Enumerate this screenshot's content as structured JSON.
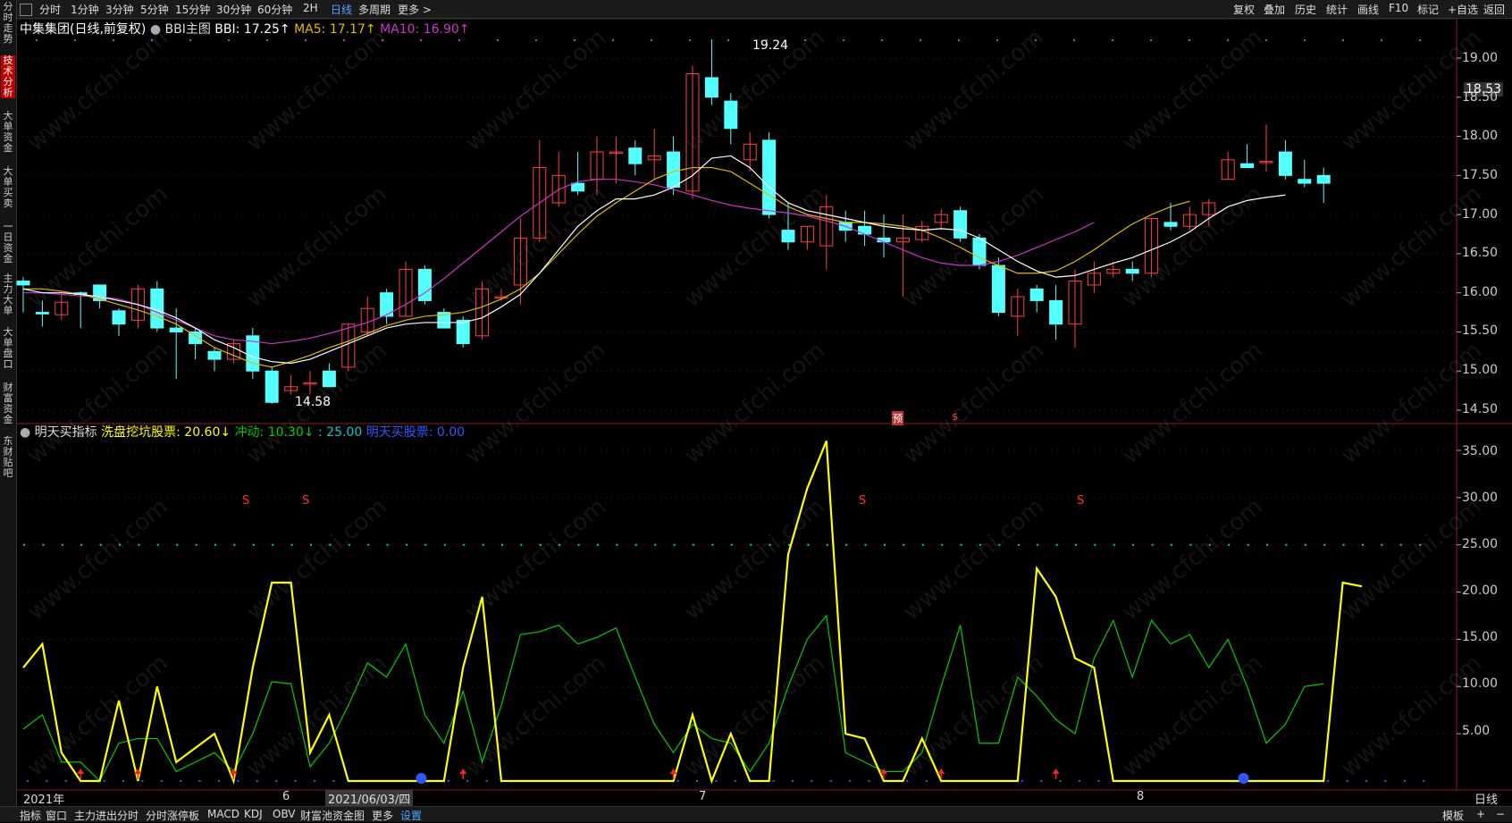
{
  "toolbar": {
    "tabs": [
      "分时",
      "1分钟",
      "3分钟",
      "5分钟",
      "15分钟",
      "30分钟",
      "60分钟",
      "2H",
      "日线",
      "多周期",
      "更多 >"
    ],
    "active_tab": "日线",
    "right_buttons": [
      "复权",
      "叠加",
      "历史",
      "统计",
      "画线",
      "F10",
      "标记",
      "+自选",
      "返回"
    ]
  },
  "sidebar": {
    "items": [
      "分时走势",
      "技术分析",
      "大单资金",
      "大单买卖",
      "一日资金",
      "主力大单",
      "大单盘口",
      "财富资金",
      "东财贴吧"
    ],
    "active_item": "技术分析"
  },
  "main_panel": {
    "title": "中集集团(日线,前复权)",
    "indicator_name": "BBI主图",
    "bbi_label": "BBI: 17.25↑",
    "ma5_label": "MA5: 17.17↑",
    "ma10_label": "MA10: 16.90↑",
    "high_label": "19.24",
    "low_label": "14.58",
    "current_price": "18.53",
    "yu_marker": "预",
    "s_marker": "$",
    "y_axis": [
      "19.00",
      "18.50",
      "18.00",
      "17.50",
      "17.00",
      "16.50",
      "16.00",
      "15.50",
      "15.00",
      "14.50"
    ]
  },
  "sub_panel": {
    "title": "明天买指标",
    "label1": "洗盘挖坑股票: 20.60↓",
    "label2": "冲动: 10.30↓",
    "label3": ": 25.00",
    "label4": "明天买股票: 0.00",
    "s_label": "S",
    "y_axis": [
      "35.00",
      "30.00",
      "25.00",
      "20.00",
      "15.00",
      "10.00",
      "5.00"
    ]
  },
  "dates": {
    "year": "2021年",
    "m6": "6",
    "selected": "2021/06/03/四",
    "m7": "7",
    "m8": "8",
    "period": "日线"
  },
  "bottom_tabs": [
    "指标",
    "窗口",
    "主力进出分时",
    "分时涨停板",
    "MACD",
    "KDJ",
    "OBV",
    "财富池资金图",
    "更多",
    "设置"
  ],
  "bottom_right": [
    "模板",
    "+",
    "−"
  ],
  "watermark": "www.cfchi.com",
  "colors": {
    "up": "#ff4040",
    "down": "#54ffff",
    "bbi": "#ffffff",
    "ma5": "#e6b800",
    "ma10": "#cc33cc",
    "yellow_line": "#ffff00",
    "green_line": "#00cc00",
    "dotted": "#00cccc",
    "background": "#000000"
  },
  "candles": [
    [
      16.15,
      16.1,
      16.2,
      15.75
    ],
    [
      15.75,
      15.73,
      15.9,
      15.57
    ],
    [
      15.72,
      15.88,
      15.98,
      15.65
    ],
    [
      16.0,
      15.98,
      16.02,
      15.55
    ],
    [
      16.1,
      15.9,
      16.1,
      15.8
    ],
    [
      15.77,
      15.6,
      15.8,
      15.45
    ],
    [
      15.65,
      16.05,
      16.1,
      15.55
    ],
    [
      16.05,
      15.55,
      16.15,
      15.5
    ],
    [
      15.55,
      15.5,
      15.8,
      14.9
    ],
    [
      15.5,
      15.35,
      15.55,
      15.15
    ],
    [
      15.25,
      15.15,
      15.3,
      15.0
    ],
    [
      15.15,
      15.35,
      15.4,
      15.1
    ],
    [
      15.45,
      15.0,
      15.55,
      14.9
    ],
    [
      15.0,
      14.6,
      15.05,
      14.58
    ],
    [
      14.75,
      14.8,
      14.95,
      14.7
    ],
    [
      14.85,
      14.85,
      15.0,
      14.7
    ],
    [
      15.0,
      14.8,
      15.1,
      14.8
    ],
    [
      15.05,
      15.6,
      15.6,
      15.0
    ],
    [
      15.5,
      15.8,
      15.95,
      15.45
    ],
    [
      16.0,
      15.7,
      16.05,
      15.6
    ],
    [
      15.7,
      16.3,
      16.4,
      15.7
    ],
    [
      16.3,
      15.9,
      16.35,
      15.85
    ],
    [
      15.75,
      15.55,
      15.8,
      15.55
    ],
    [
      15.65,
      15.35,
      15.7,
      15.3
    ],
    [
      15.45,
      16.05,
      16.15,
      15.4
    ],
    [
      15.95,
      15.95,
      16.05,
      15.9
    ],
    [
      16.1,
      16.7,
      16.95,
      15.85
    ],
    [
      16.7,
      17.6,
      17.95,
      16.65
    ],
    [
      17.15,
      17.5,
      17.8,
      17.1
    ],
    [
      17.4,
      17.3,
      17.8,
      17.25
    ],
    [
      17.45,
      17.8,
      18.0,
      17.25
    ],
    [
      17.8,
      17.8,
      18.0,
      17.4
    ],
    [
      17.85,
      17.65,
      17.95,
      17.5
    ],
    [
      17.7,
      17.75,
      18.1,
      17.45
    ],
    [
      17.8,
      17.35,
      18.0,
      17.25
    ],
    [
      17.3,
      18.8,
      18.9,
      17.2
    ],
    [
      18.75,
      18.5,
      19.24,
      18.4
    ],
    [
      18.45,
      18.1,
      18.55,
      17.9
    ],
    [
      17.7,
      17.9,
      18.05,
      17.55
    ],
    [
      17.95,
      17.0,
      18.05,
      16.95
    ],
    [
      16.8,
      16.65,
      17.15,
      16.55
    ],
    [
      16.65,
      16.85,
      16.85,
      16.55
    ],
    [
      16.6,
      17.1,
      17.25,
      16.3
    ],
    [
      16.9,
      16.8,
      17.05,
      16.65
    ],
    [
      16.85,
      16.75,
      17.05,
      16.6
    ],
    [
      16.7,
      16.65,
      17.0,
      16.45
    ],
    [
      16.65,
      16.7,
      17.0,
      15.95
    ],
    [
      16.68,
      16.85,
      16.92,
      16.65
    ],
    [
      16.9,
      17.0,
      17.07,
      16.8
    ],
    [
      17.05,
      16.7,
      17.1,
      16.65
    ],
    [
      16.7,
      16.35,
      16.75,
      16.3
    ],
    [
      16.35,
      15.75,
      16.45,
      15.7
    ],
    [
      15.7,
      15.95,
      16.05,
      15.45
    ],
    [
      16.05,
      15.9,
      16.1,
      15.75
    ],
    [
      15.9,
      15.6,
      16.1,
      15.4
    ],
    [
      15.6,
      16.15,
      16.3,
      15.3
    ],
    [
      16.1,
      16.25,
      16.4,
      16.0
    ],
    [
      16.25,
      16.3,
      16.4,
      16.2
    ],
    [
      16.3,
      16.25,
      16.4,
      16.15
    ],
    [
      16.25,
      16.95,
      16.95,
      16.2
    ],
    [
      16.9,
      16.85,
      17.15,
      16.8
    ],
    [
      16.85,
      17.0,
      17.1,
      16.8
    ],
    [
      17.0,
      17.15,
      17.2,
      16.85
    ],
    [
      17.45,
      17.7,
      17.8,
      17.45
    ],
    [
      17.65,
      17.6,
      17.9,
      17.6
    ],
    [
      17.68,
      17.68,
      18.15,
      17.55
    ],
    [
      17.8,
      17.5,
      17.95,
      17.45
    ],
    [
      17.45,
      17.4,
      17.7,
      17.35
    ],
    [
      17.5,
      17.4,
      17.6,
      17.15
    ]
  ],
  "bbi": [
    16.05,
    16.0,
    16.0,
    15.98,
    15.95,
    15.9,
    15.85,
    15.78,
    15.68,
    15.55,
    15.4,
    15.3,
    15.18,
    15.12,
    15.1,
    15.15,
    15.25,
    15.35,
    15.45,
    15.55,
    15.6,
    15.62,
    15.62,
    15.62,
    15.68,
    15.82,
    15.98,
    16.25,
    16.55,
    16.85,
    17.05,
    17.2,
    17.2,
    17.25,
    17.35,
    17.5,
    17.72,
    17.75,
    17.6,
    17.35,
    17.15,
    17.05,
    17.0,
    16.95,
    16.9,
    16.85,
    16.82,
    16.8,
    16.82,
    16.8,
    16.7,
    16.55,
    16.4,
    16.28,
    16.2,
    16.22,
    16.3,
    16.38,
    16.45,
    16.55,
    16.65,
    16.78,
    16.95,
    17.1,
    17.18,
    17.22,
    17.25
  ],
  "ma5": [
    16.05,
    16.05,
    16.02,
    15.98,
    15.92,
    15.85,
    15.78,
    15.7,
    15.6,
    15.45,
    15.3,
    15.2,
    15.1,
    15.05,
    15.12,
    15.2,
    15.3,
    15.38,
    15.48,
    15.58,
    15.65,
    15.7,
    15.72,
    15.75,
    15.82,
    15.92,
    16.05,
    16.25,
    16.5,
    16.75,
    16.98,
    17.15,
    17.3,
    17.45,
    17.55,
    17.6,
    17.6,
    17.55,
    17.4,
    17.25,
    17.1,
    17.0,
    16.95,
    16.9,
    16.9,
    16.88,
    16.85,
    16.8,
    16.7,
    16.58,
    16.45,
    16.35,
    16.25,
    16.25,
    16.28,
    16.4,
    16.55,
    16.72,
    16.88,
    17.0,
    17.1,
    17.17
  ],
  "ma10": [
    16.0,
    16.0,
    15.98,
    15.96,
    15.95,
    15.92,
    15.85,
    15.75,
    15.65,
    15.55,
    15.45,
    15.4,
    15.38,
    15.35,
    15.38,
    15.42,
    15.48,
    15.55,
    15.62,
    15.72,
    15.85,
    16.0,
    16.18,
    16.38,
    16.58,
    16.78,
    16.98,
    17.15,
    17.32,
    17.42,
    17.45,
    17.45,
    17.42,
    17.38,
    17.32,
    17.25,
    17.18,
    17.12,
    17.08,
    17.05,
    17.02,
    16.98,
    16.92,
    16.85,
    16.75,
    16.65,
    16.55,
    16.45,
    16.38,
    16.35,
    16.35,
    16.4,
    16.48,
    16.58,
    16.68,
    16.78,
    16.9
  ],
  "yellow": [
    12,
    14.5,
    3,
    0,
    0,
    8.5,
    0,
    10,
    2,
    3.5,
    5,
    0,
    12,
    21,
    21,
    3,
    7,
    0,
    0,
    0,
    0,
    0,
    0,
    12,
    19.5,
    0,
    0,
    0,
    0,
    0,
    0,
    0,
    0,
    0,
    0,
    7,
    0,
    5,
    0,
    0,
    24,
    31,
    36,
    5,
    4.5,
    0,
    0,
    4.5,
    0,
    0,
    0,
    0,
    0,
    22.5,
    19.5,
    13,
    12,
    0,
    0,
    0,
    0,
    0,
    0,
    0,
    0,
    0,
    0,
    0,
    0,
    21,
    20.6
  ],
  "green": [
    5.5,
    7,
    2,
    2,
    0,
    4,
    4.5,
    4.5,
    1,
    2,
    3,
    1,
    5,
    10.5,
    10.3,
    1.5,
    4,
    8,
    12.5,
    11,
    14.5,
    7,
    4,
    9.5,
    2,
    8,
    15.5,
    15.8,
    16.5,
    14.5,
    15.2,
    16.2,
    11,
    6,
    3,
    6,
    4.5,
    4,
    1,
    4,
    10,
    15,
    17.5,
    3,
    2,
    1,
    1,
    3,
    10,
    16.5,
    4,
    4,
    11,
    9,
    6.5,
    5,
    13,
    17,
    11,
    17,
    14.5,
    15.5,
    12,
    15,
    10,
    4,
    6,
    10,
    10.3
  ]
}
